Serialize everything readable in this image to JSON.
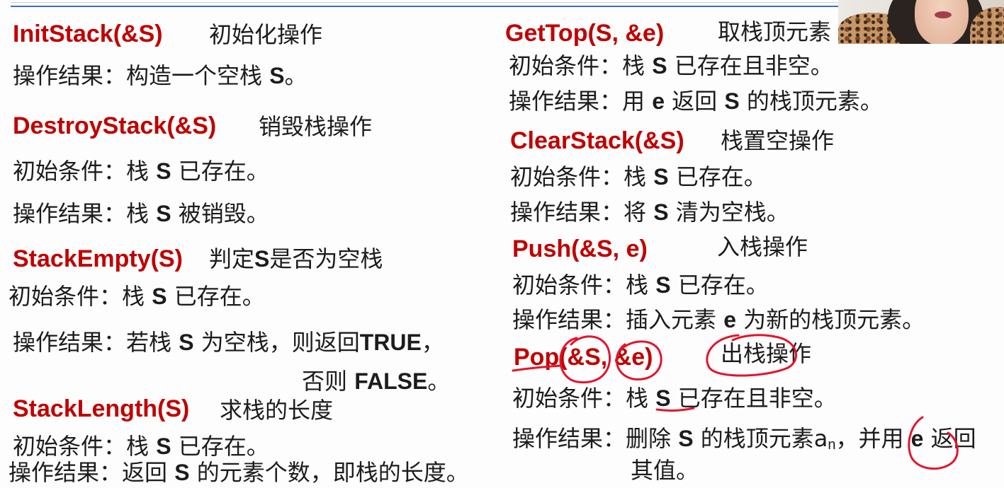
{
  "colors": {
    "heading": "#c00000",
    "text": "#1c1c1c",
    "annotation": "#e3142b",
    "rule": "#3f6fb8"
  },
  "left": {
    "init_stack": {
      "signature": "InitStack(&S)",
      "title": "初始化操作",
      "result": [
        "操作结果：构造一个空栈 ",
        "S",
        "。"
      ]
    },
    "destroy_stack": {
      "signature": "DestroyStack(&S)",
      "title": "销毁栈操作",
      "condition": [
        "初始条件：栈 ",
        "S",
        " 已存在。"
      ],
      "result": [
        "操作结果：栈 ",
        "S",
        " 被销毁。"
      ]
    },
    "stack_empty": {
      "signature": "StackEmpty(S)",
      "title": [
        "判定",
        "S",
        "是否为空栈"
      ],
      "condition": [
        "初始条件：栈 ",
        "S",
        " 已存在。"
      ],
      "result": [
        "操作结果：若栈 ",
        "S",
        " 为空栈，则返回",
        "TRUE",
        "，"
      ],
      "result_cont": [
        "否则 ",
        "FALSE",
        "。"
      ]
    },
    "stack_length": {
      "signature": "StackLength(S)",
      "title": "求栈的长度",
      "condition": [
        "初始条件：栈 ",
        "S",
        " 已存在。"
      ],
      "result": [
        "操作结果：返回 ",
        "S",
        " 的元素个数，即栈的长度。"
      ]
    }
  },
  "right": {
    "get_top": {
      "signature": "GetTop(S, &e)",
      "title": "取栈顶元素",
      "condition": [
        "初始条件：栈 ",
        "S",
        " 已存在且非空。"
      ],
      "result": [
        "操作结果：用 ",
        "e",
        " 返回 ",
        "S",
        " 的栈顶元素。"
      ]
    },
    "clear_stack": {
      "signature": "ClearStack(&S)",
      "title": "栈置空操作",
      "condition": [
        "初始条件：栈 ",
        "S",
        " 已存在。"
      ],
      "result": [
        "操作结果：将 ",
        "S",
        " 清为空栈。"
      ]
    },
    "push": {
      "signature": "Push(&S, e)",
      "title": "入栈操作",
      "condition": [
        "初始条件：栈 ",
        "S",
        " 已存在。"
      ],
      "result": [
        "操作结果：插入元素 ",
        "e",
        " 为新的栈顶元素。"
      ]
    },
    "pop": {
      "signature": "Pop(&S, &e)",
      "title": "出栈操作",
      "condition": [
        "初始条件：栈 ",
        "S",
        " 已存在且非空。"
      ],
      "result": [
        "操作结果：删除 ",
        "S",
        " 的栈顶元素a",
        "n",
        "，并用 ",
        "e",
        " 返回"
      ],
      "result_cont": "其值。"
    }
  }
}
